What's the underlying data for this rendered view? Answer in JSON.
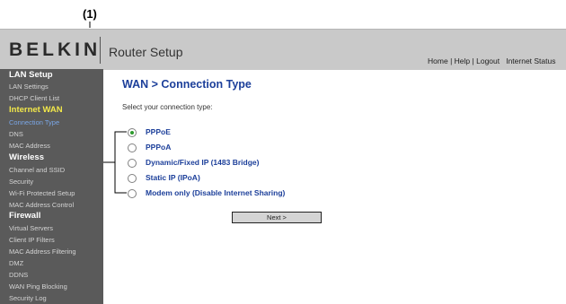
{
  "callout": "(1)",
  "header": {
    "logo": "BELKIN",
    "title": "Router Setup",
    "links": [
      "Home",
      "Help",
      "Logout",
      "Internet Status"
    ],
    "separator": "|"
  },
  "sidebar": {
    "items": [
      {
        "label": "LAN Setup"
      },
      {
        "label": "LAN Settings"
      },
      {
        "label": "DHCP Client List"
      },
      {
        "label": "Internet WAN"
      },
      {
        "label": "Connection Type"
      },
      {
        "label": "DNS"
      },
      {
        "label": "MAC Address"
      },
      {
        "label": "Wireless"
      },
      {
        "label": "Channel and SSID"
      },
      {
        "label": "Security"
      },
      {
        "label": "Wi-Fi Protected Setup"
      },
      {
        "label": "MAC Address Control"
      },
      {
        "label": "Firewall"
      },
      {
        "label": "Virtual Servers"
      },
      {
        "label": "Client IP Filters"
      },
      {
        "label": "MAC Address Filtering"
      },
      {
        "label": "DMZ"
      },
      {
        "label": "DDNS"
      },
      {
        "label": "WAN Ping Blocking"
      },
      {
        "label": "Security Log"
      }
    ]
  },
  "main": {
    "title": "WAN > Connection Type",
    "prompt": "Select your connection type:",
    "options": [
      {
        "label": "PPPoE",
        "selected": true
      },
      {
        "label": "PPPoA",
        "selected": false
      },
      {
        "label": "Dynamic/Fixed IP (1483 Bridge)",
        "selected": false
      },
      {
        "label": "Static IP (IPoA)",
        "selected": false
      },
      {
        "label": "Modem only (Disable Internet Sharing)",
        "selected": false
      }
    ],
    "next_label": "Next >"
  }
}
